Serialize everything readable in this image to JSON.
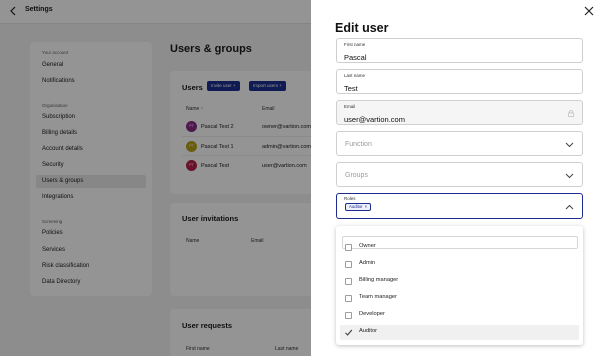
{
  "app": {
    "title": "Settings"
  },
  "sidebar": {
    "sections": [
      {
        "label": "Your account",
        "items": [
          "General",
          "Notifications"
        ]
      },
      {
        "label": "Organisation",
        "items": [
          "Subscription",
          "Billing details",
          "Account details",
          "Security",
          "Users & groups",
          "Integrations"
        ]
      },
      {
        "label": "Screening",
        "items": [
          "Policies",
          "Services",
          "Risk classification",
          "Data Directory"
        ]
      }
    ],
    "active": "Users & groups"
  },
  "main": {
    "title": "Users & groups",
    "users_card": {
      "title": "Users",
      "invite_label": "Invite user",
      "import_label": "Import users",
      "col_name": "Name",
      "col_email": "Email",
      "rows": [
        {
          "initials": "PT",
          "name": "Pascal Test 2",
          "email": "owner@vartion.com",
          "color": "#8a2b86"
        },
        {
          "initials": "PT",
          "name": "Pascal Test 1",
          "email": "admin@vartion.com",
          "color": "#b8a11c"
        },
        {
          "initials": "PT",
          "name": "Pascal Test",
          "email": "user@vartion.com",
          "color": "#b51f4a"
        }
      ]
    },
    "invitations_card": {
      "title": "User invitations",
      "col_name": "Name",
      "col_email": "Email"
    },
    "requests_card": {
      "title": "User requests",
      "col_first": "First name",
      "col_last": "Last name"
    }
  },
  "drawer": {
    "title": "Edit user",
    "first_name": {
      "label": "First name",
      "value": "Pascal"
    },
    "last_name": {
      "label": "Last name",
      "value": "Test"
    },
    "email": {
      "label": "Email",
      "value": "user@vartion.com"
    },
    "function": {
      "placeholder": "Function"
    },
    "groups": {
      "placeholder": "Groups"
    },
    "roles": {
      "label": "Roles",
      "chip": "Auditor"
    },
    "role_options": [
      {
        "label": "Owner",
        "checked": false
      },
      {
        "label": "Admin",
        "checked": false
      },
      {
        "label": "Billing manager",
        "checked": false
      },
      {
        "label": "Team manager",
        "checked": false
      },
      {
        "label": "Developer",
        "checked": false
      },
      {
        "label": "Auditor",
        "checked": true
      }
    ]
  },
  "colors": {
    "accent": "#1d2d8f",
    "overlay": "rgba(0,0,0,0.42)"
  },
  "icons": [
    "back-arrow-icon",
    "close-icon",
    "chevron-down-icon",
    "chevron-up-icon",
    "lock-icon",
    "chip-remove-icon",
    "checkmark-icon",
    "plus-icon",
    "sort-icon"
  ]
}
